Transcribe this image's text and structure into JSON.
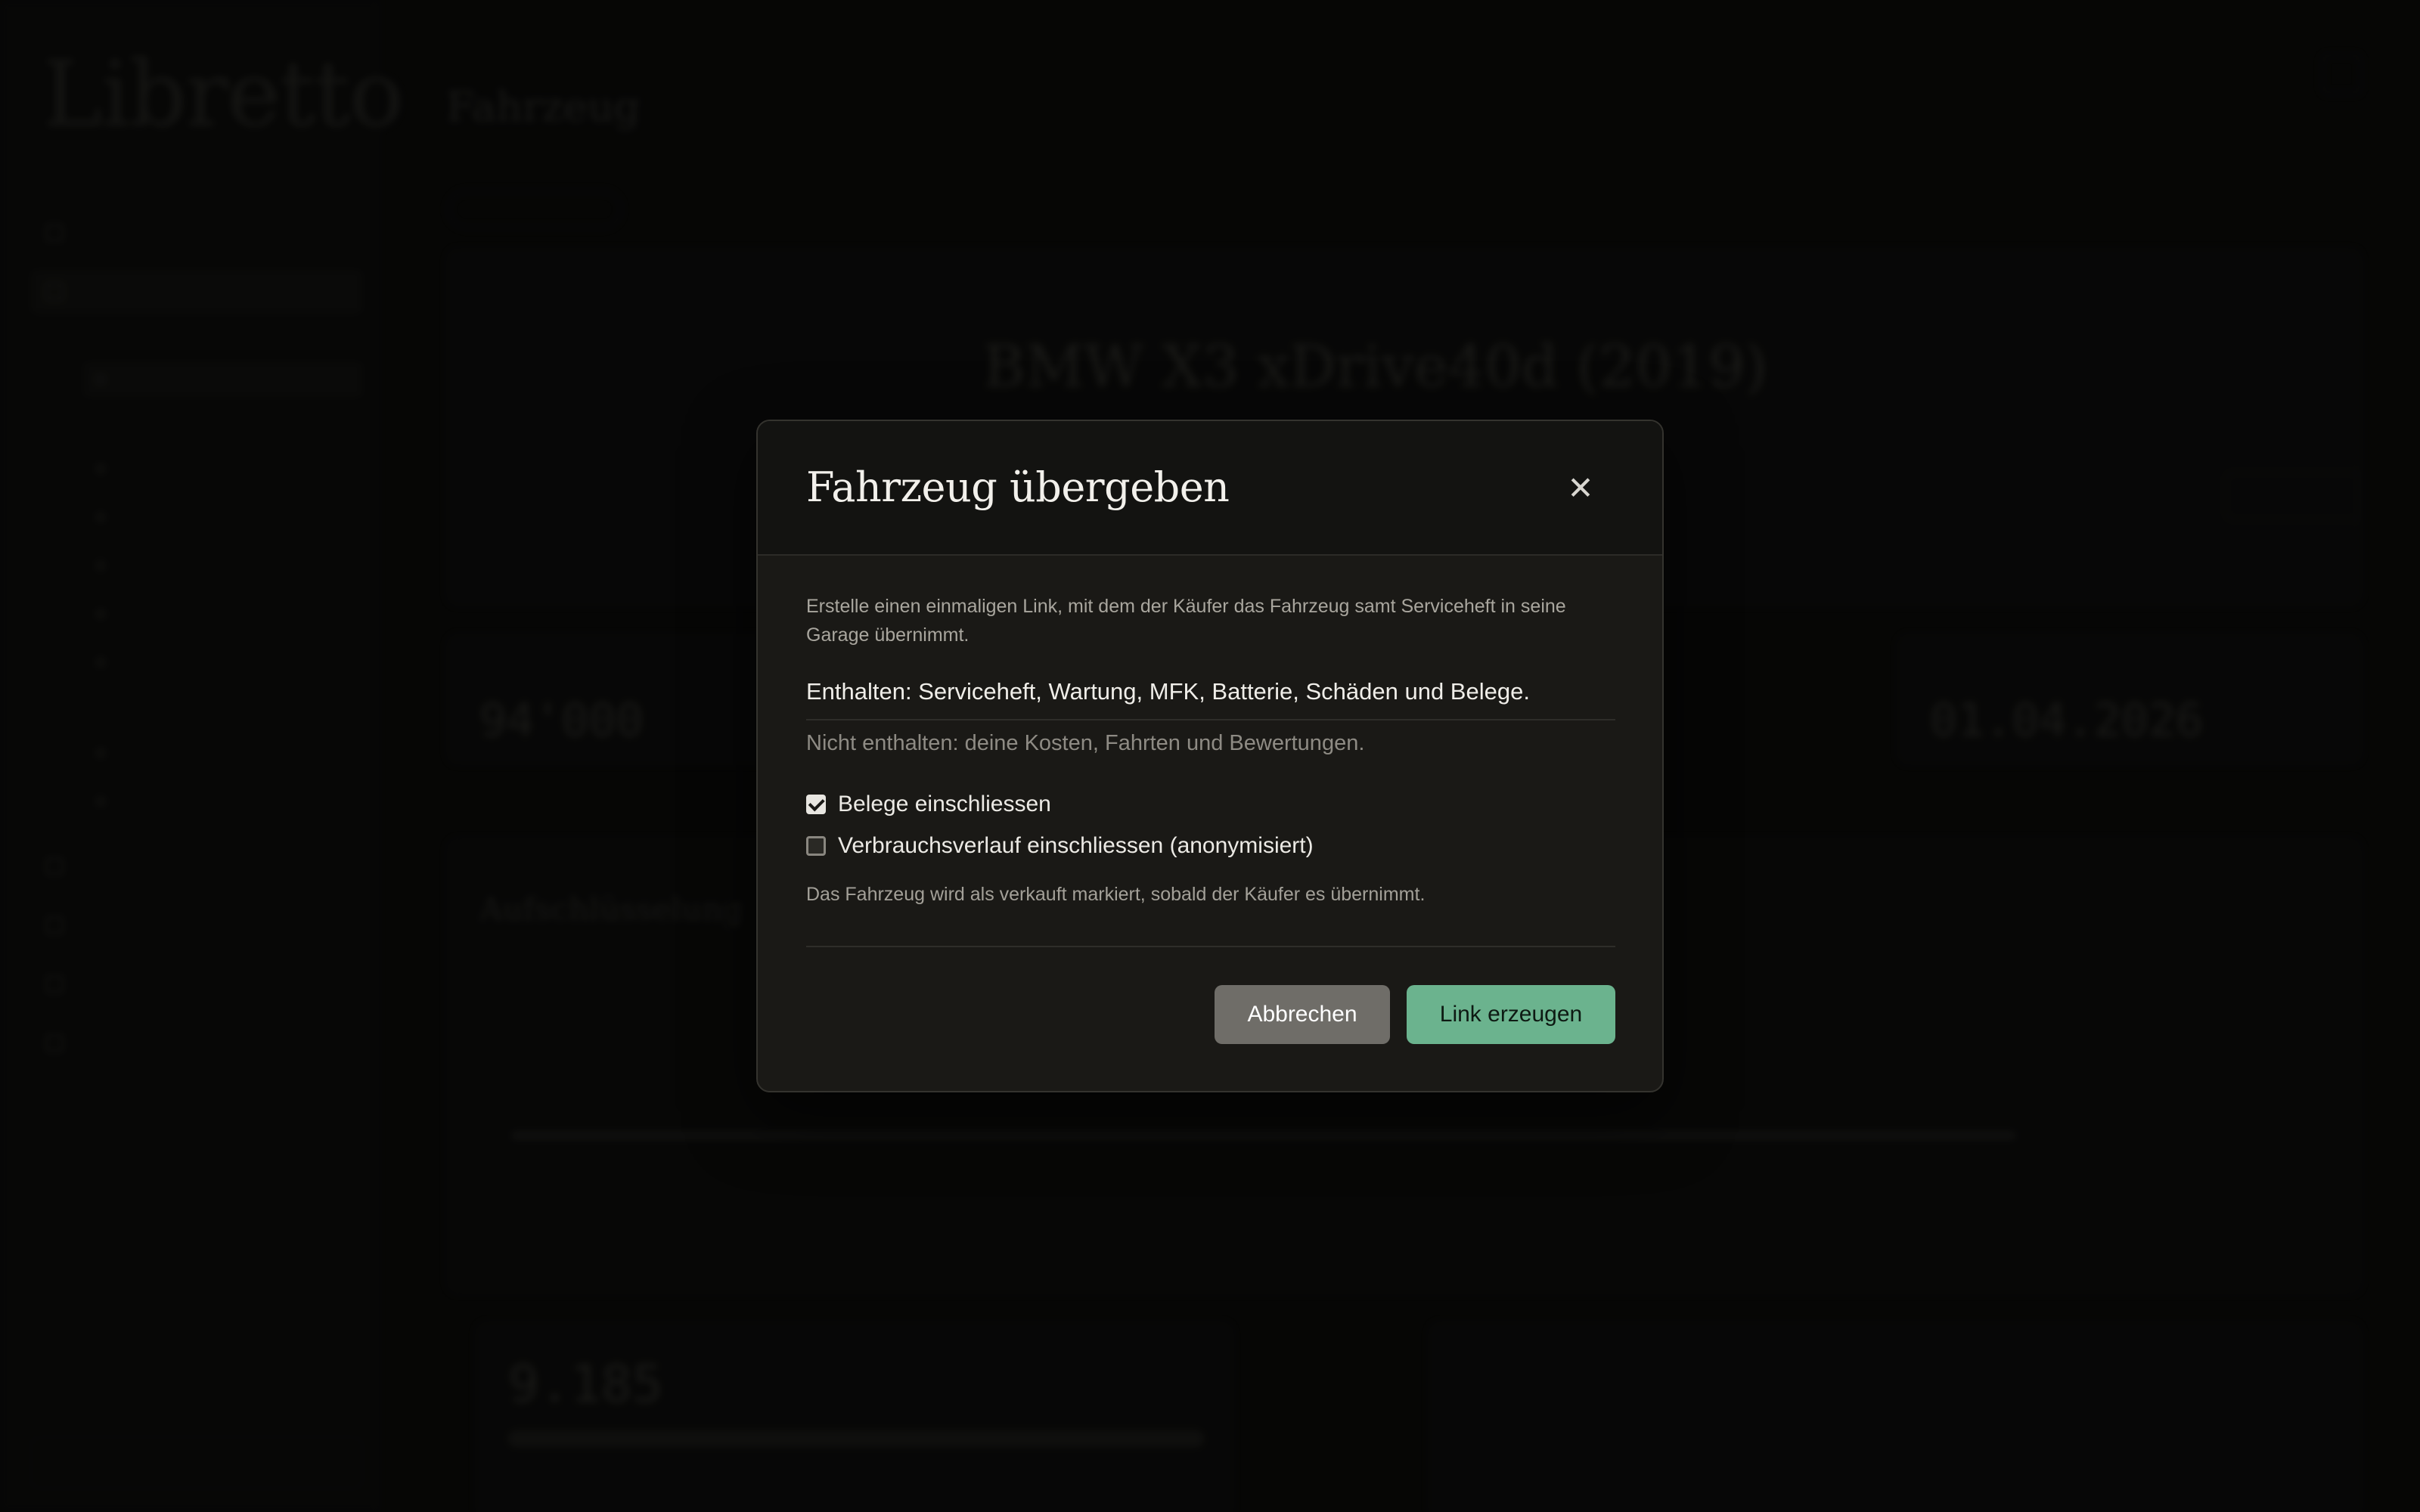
{
  "sidebar": {
    "logo": "Libretto",
    "tagline": "",
    "logout": ""
  },
  "main": {
    "breadcrumb": "",
    "title": "Fahrzeug",
    "hero_brand": "BMW  X3 xDrive40d (2019)",
    "stat_1_value": "94'000",
    "stat_2_value": "01.04.2026",
    "section_title": "Aufschlüsselung",
    "big_number": "9.185"
  },
  "modal": {
    "title": "Fahrzeug übergeben",
    "close_label": "✕",
    "description": "Erstelle einen einmaligen Link, mit dem der Käufer das Fahrzeug samt Serviceheft in seine Garage übernimmt.",
    "included": "Enthalten: Serviceheft, Wartung, MFK, Batterie, Schäden und Belege.",
    "excluded": "Nicht enthalten: deine Kosten, Fahrten und Bewertungen.",
    "checkbox_receipts": {
      "label": "Belege einschliessen",
      "checked": true
    },
    "checkbox_consumption": {
      "label": "Verbrauchsverlauf einschliessen (anonymisiert)",
      "checked": false
    },
    "note": "Das Fahrzeug wird als verkauft markiert, sobald der Käufer es übernimmt.",
    "cancel_label": "Abbrechen",
    "primary_label": "Link erzeugen"
  },
  "colors": {
    "accent": "#6bb38e",
    "modal_bg": "#1a1916",
    "cancel_bg": "#6f6d68"
  }
}
